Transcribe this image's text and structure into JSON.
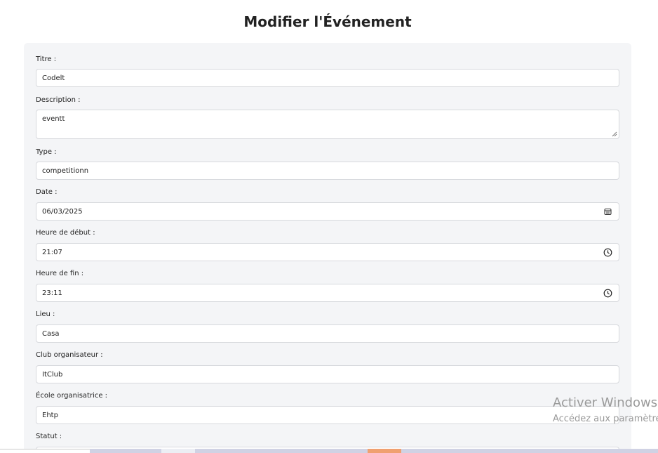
{
  "page": {
    "title": "Modifier l'Événement"
  },
  "form": {
    "fields": [
      {
        "key": "titre",
        "label": "Titre :",
        "value": "Codelt"
      },
      {
        "key": "description",
        "label": "Description :",
        "value": "eventt"
      },
      {
        "key": "type",
        "label": "Type :",
        "value": "competitionn"
      },
      {
        "key": "date",
        "label": "Date :",
        "value": "06/03/2025",
        "icon": "calendar-icon"
      },
      {
        "key": "heure_debut",
        "label": "Heure de début :",
        "value": "21:07",
        "icon": "clock-icon"
      },
      {
        "key": "heure_fin",
        "label": "Heure de fin :",
        "value": "23:11",
        "icon": "clock-icon"
      },
      {
        "key": "lieu",
        "label": "Lieu :",
        "value": "Casa"
      },
      {
        "key": "club",
        "label": "Club organisateur :",
        "value": "ItClub"
      },
      {
        "key": "ecole",
        "label": "École organisatrice :",
        "value": "Ehtp"
      },
      {
        "key": "statut",
        "label": "Statut :",
        "value": ""
      }
    ]
  },
  "watermark": {
    "title": "Activer Windows",
    "subtitle": "Accédez aux paramètres"
  },
  "colors": {
    "card_background": "#f4f5f7",
    "input_border": "#d7d9dd",
    "watermark": "#9a9a9a",
    "strip_accent": "#f0a070",
    "strip_muted": "#d0d2e4"
  }
}
